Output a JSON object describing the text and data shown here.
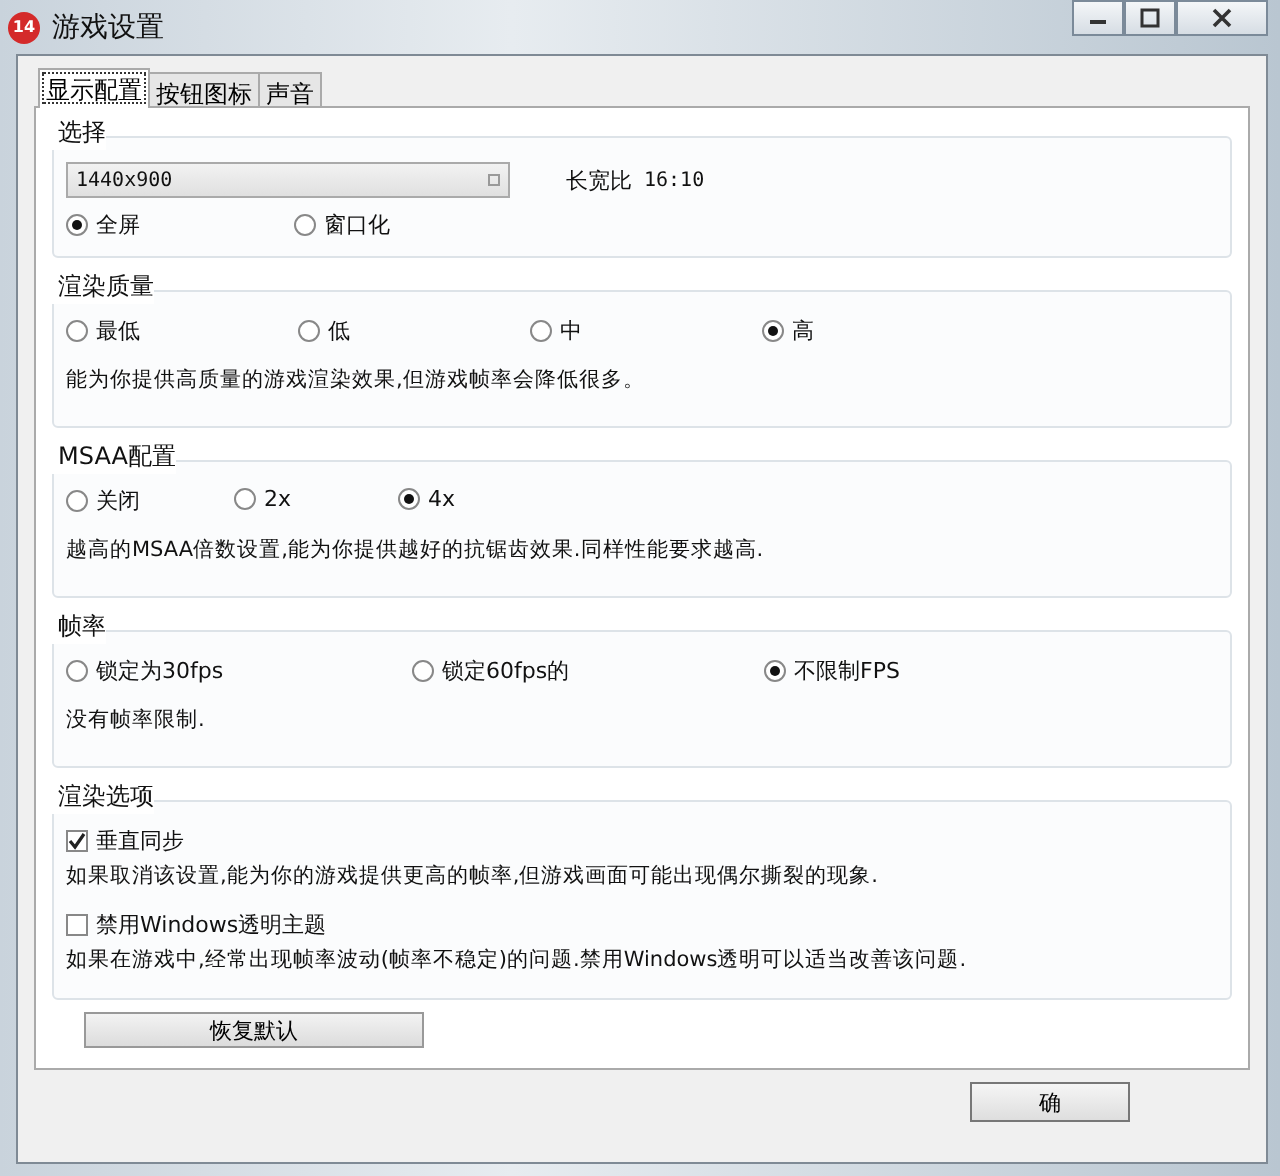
{
  "window": {
    "title": "游戏设置",
    "icon_text": "14"
  },
  "tabs": [
    {
      "label": "显示配置",
      "selected": true
    },
    {
      "label": "按钮图标",
      "selected": false
    },
    {
      "label": "声音",
      "selected": false
    }
  ],
  "groups": [
    {
      "kind": "resolution",
      "title": "选择",
      "resolution": "1440x900",
      "aspect_label": "长宽比",
      "aspect_value": "16:10",
      "options": [
        {
          "label": "全屏",
          "selected": true
        },
        {
          "label": "窗口化",
          "selected": false
        }
      ]
    },
    {
      "kind": "radios",
      "title": "渲染质量",
      "options": [
        {
          "label": "最低",
          "selected": false
        },
        {
          "label": "低",
          "selected": false
        },
        {
          "label": "中",
          "selected": false
        },
        {
          "label": "高",
          "selected": true
        }
      ],
      "description": "能为你提供高质量的游戏渲染效果,但游戏帧率会降低很多。"
    },
    {
      "kind": "radios",
      "title": "MSAA配置",
      "options": [
        {
          "label": "关闭",
          "selected": false
        },
        {
          "label": "2x",
          "selected": false
        },
        {
          "label": "4x",
          "selected": true
        }
      ],
      "description": "越高的MSAA倍数设置,能为你提供越好的抗锯齿效果.同样性能要求越高."
    },
    {
      "kind": "radios",
      "title": "帧率",
      "options": [
        {
          "label": "锁定为30fps",
          "selected": false
        },
        {
          "label": "锁定60fps的",
          "selected": false
        },
        {
          "label": "不限制FPS",
          "selected": true
        }
      ],
      "description": "没有帧率限制."
    },
    {
      "kind": "checks",
      "title": "渲染选项",
      "items": [
        {
          "label": "垂直同步",
          "checked": true,
          "description": "如果取消该设置,能为你的游戏提供更高的帧率,但游戏画面可能出现偶尔撕裂的现象."
        },
        {
          "label": "禁用Windows透明主题",
          "checked": false,
          "description": "如果在游戏中,经常出现帧率波动(帧率不稳定)的问题.禁用Windows透明可以适当改善该问题."
        }
      ]
    }
  ],
  "reset_button": "恢复默认",
  "footer_button": "确"
}
